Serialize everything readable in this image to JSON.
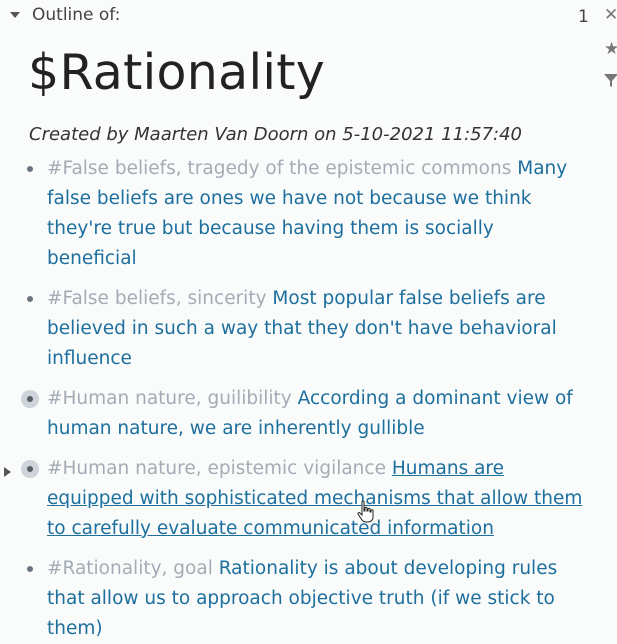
{
  "header": {
    "label": "Outline of:",
    "ref_count": "1",
    "side_icons": [
      "close-icon",
      "star-icon",
      "filter-icon"
    ]
  },
  "page": {
    "title": "$Rationality",
    "created_line": "Created by Maarten Van Doorn on 5-10-2021 11:57:40"
  },
  "items": [
    {
      "tag": "#False beliefs, tragedy of the epistemic commons",
      "text": "Many false beliefs are ones we have not because we think they're true but because having them is socially beneficial",
      "bullet": "dot"
    },
    {
      "tag": "#False beliefs, sincerity",
      "text": "Most popular false beliefs are believed in such a way that they don't have behavioral influence",
      "bullet": "dot"
    },
    {
      "tag": "#Human nature, guilibility",
      "text": "According a dominant view of human nature, we are inherently gullible",
      "bullet": "ring"
    },
    {
      "tag": "#Human nature, epistemic vigilance",
      "text": "Humans are equipped with sophisticated mechanisms that allow them to carefully evaluate communicated information",
      "bullet": "ring",
      "has_children": true,
      "hovered": true
    },
    {
      "tag": "#Rationality, goal",
      "text": "Rationality is about developing rules that allow us to approach objective truth (if we stick to them)",
      "bullet": "dot"
    }
  ]
}
